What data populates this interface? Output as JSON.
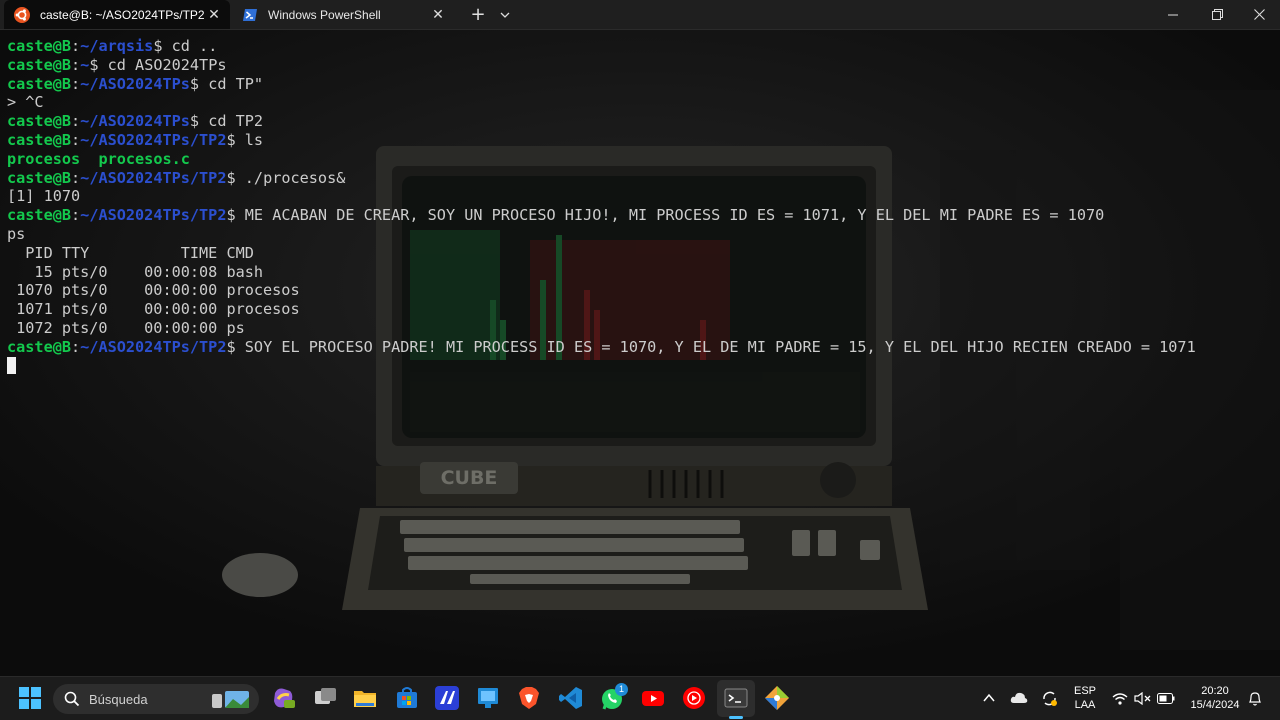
{
  "tabs": [
    {
      "title": "caste@B: ~/ASO2024TPs/TP2",
      "icon": "ubuntu-icon",
      "active": true
    },
    {
      "title": "Windows PowerShell",
      "icon": "powershell-icon",
      "active": false
    }
  ],
  "titlebar": {
    "new_tab": "+",
    "dropdown": "⌄",
    "minimize": "─",
    "maximize": "❐",
    "close": "✕"
  },
  "wallpaper": {
    "brand": "CUBE"
  },
  "terminal": {
    "user": "caste@B",
    "lines": [
      {
        "type": "prompt",
        "path": "~/arqsis",
        "cmd": "cd .."
      },
      {
        "type": "prompt",
        "path": "~",
        "cmd": "cd ASO2024TPs"
      },
      {
        "type": "prompt",
        "path": "~/ASO2024TPs",
        "cmd": "cd TP\""
      },
      {
        "type": "text",
        "text": "> ^C"
      },
      {
        "type": "prompt",
        "path": "~/ASO2024TPs",
        "cmd": "cd TP2"
      },
      {
        "type": "prompt",
        "path": "~/ASO2024TPs/TP2",
        "cmd": "ls"
      },
      {
        "type": "ls",
        "items": [
          "procesos",
          "procesos.c"
        ]
      },
      {
        "type": "prompt",
        "path": "~/ASO2024TPs/TP2",
        "cmd": "./procesos&"
      },
      {
        "type": "text",
        "text": "[1] 1070"
      },
      {
        "type": "prompt",
        "path": "~/ASO2024TPs/TP2",
        "cmd": "ME ACABAN DE CREAR, SOY UN PROCESO HIJO!, MI PROCESS ID ES = 1071, Y EL DEL MI PADRE ES = 1070"
      },
      {
        "type": "text",
        "text": "ps"
      },
      {
        "type": "text",
        "text": "  PID TTY          TIME CMD"
      },
      {
        "type": "text",
        "text": "   15 pts/0    00:00:08 bash"
      },
      {
        "type": "text",
        "text": " 1070 pts/0    00:00:00 procesos"
      },
      {
        "type": "text",
        "text": " 1071 pts/0    00:00:00 procesos"
      },
      {
        "type": "text",
        "text": " 1072 pts/0    00:00:00 ps"
      },
      {
        "type": "prompt",
        "path": "~/ASO2024TPs/TP2",
        "cmd": "SOY EL PROCESO PADRE! MI PROCESS ID ES = 1070, Y EL DE MI PADRE = 15, Y EL DEL HIJO RECIEN CREADO = 1071"
      },
      {
        "type": "cursor"
      }
    ]
  },
  "taskbar": {
    "search_placeholder": "Búsqueda",
    "apps": [
      "windows-start-icon",
      "copilot-icon",
      "task-view-icon",
      "file-explorer-icon",
      "microsoft-store-icon",
      "app-icon",
      "taskbar-app-icon",
      "brave-icon",
      "vscode-icon",
      "whatsapp-icon",
      "youtube-icon",
      "youtube-music-icon",
      "terminal-icon",
      "git-icon"
    ],
    "whatsapp_badge": "1",
    "tray": {
      "lang": "ESP",
      "layout": "LAA",
      "time": "20:20",
      "date": "15/4/2024"
    }
  }
}
